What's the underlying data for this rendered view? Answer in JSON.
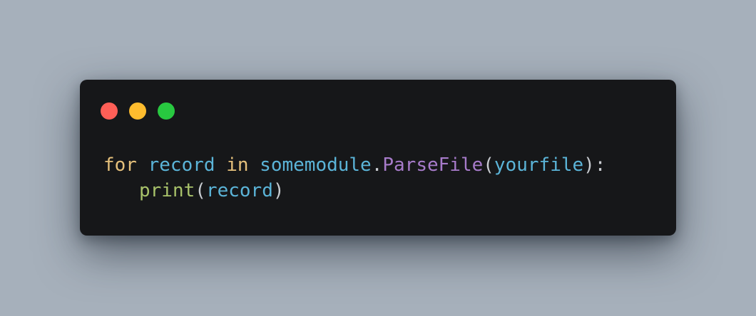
{
  "window_controls": {
    "close_color": "#ff5f57",
    "minimize_color": "#febc2e",
    "maximize_color": "#28c840"
  },
  "colors": {
    "keyword": "#e5c07b",
    "identifier": "#5bb4d8",
    "function": "#a77bca",
    "builtin": "#a8c26a",
    "punctuation": "#c9ccd1",
    "background": "#161719",
    "page": "#a6b0bb"
  },
  "code": {
    "line1": {
      "kw_for": "for",
      "var_record": "record",
      "kw_in": "in",
      "module": "somemodule",
      "dot": ".",
      "method": "ParseFile",
      "open_paren": "(",
      "arg": "yourfile",
      "close_colon": "):"
    },
    "line2": {
      "func": "print",
      "open_paren": "(",
      "arg": "record",
      "close_paren": ")"
    }
  }
}
